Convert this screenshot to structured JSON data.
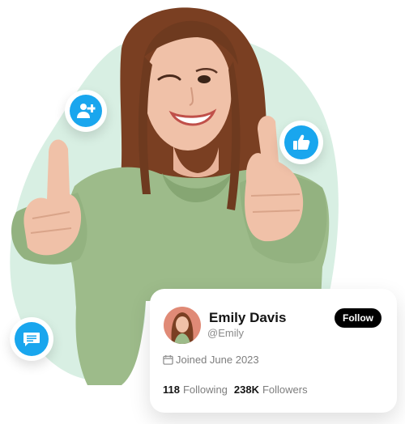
{
  "profile_card": {
    "name": "Emily Davis",
    "handle": "@Emily",
    "follow_label": "Follow",
    "joined": "Joined June 2023",
    "following_count": "118",
    "following_label": "Following",
    "followers_count": "238K",
    "followers_label": "Followers"
  },
  "icons": [
    "add-user-icon",
    "thumbs-up-icon",
    "message-icon",
    "calendar-icon"
  ],
  "colors": {
    "accent_blue": "#19a6ee",
    "mint_blob": "#d8efe3",
    "hoodie_green": "#9dbb8a",
    "button_black": "#000000",
    "text_dark": "#141414",
    "text_muted": "#7e7e7e"
  }
}
